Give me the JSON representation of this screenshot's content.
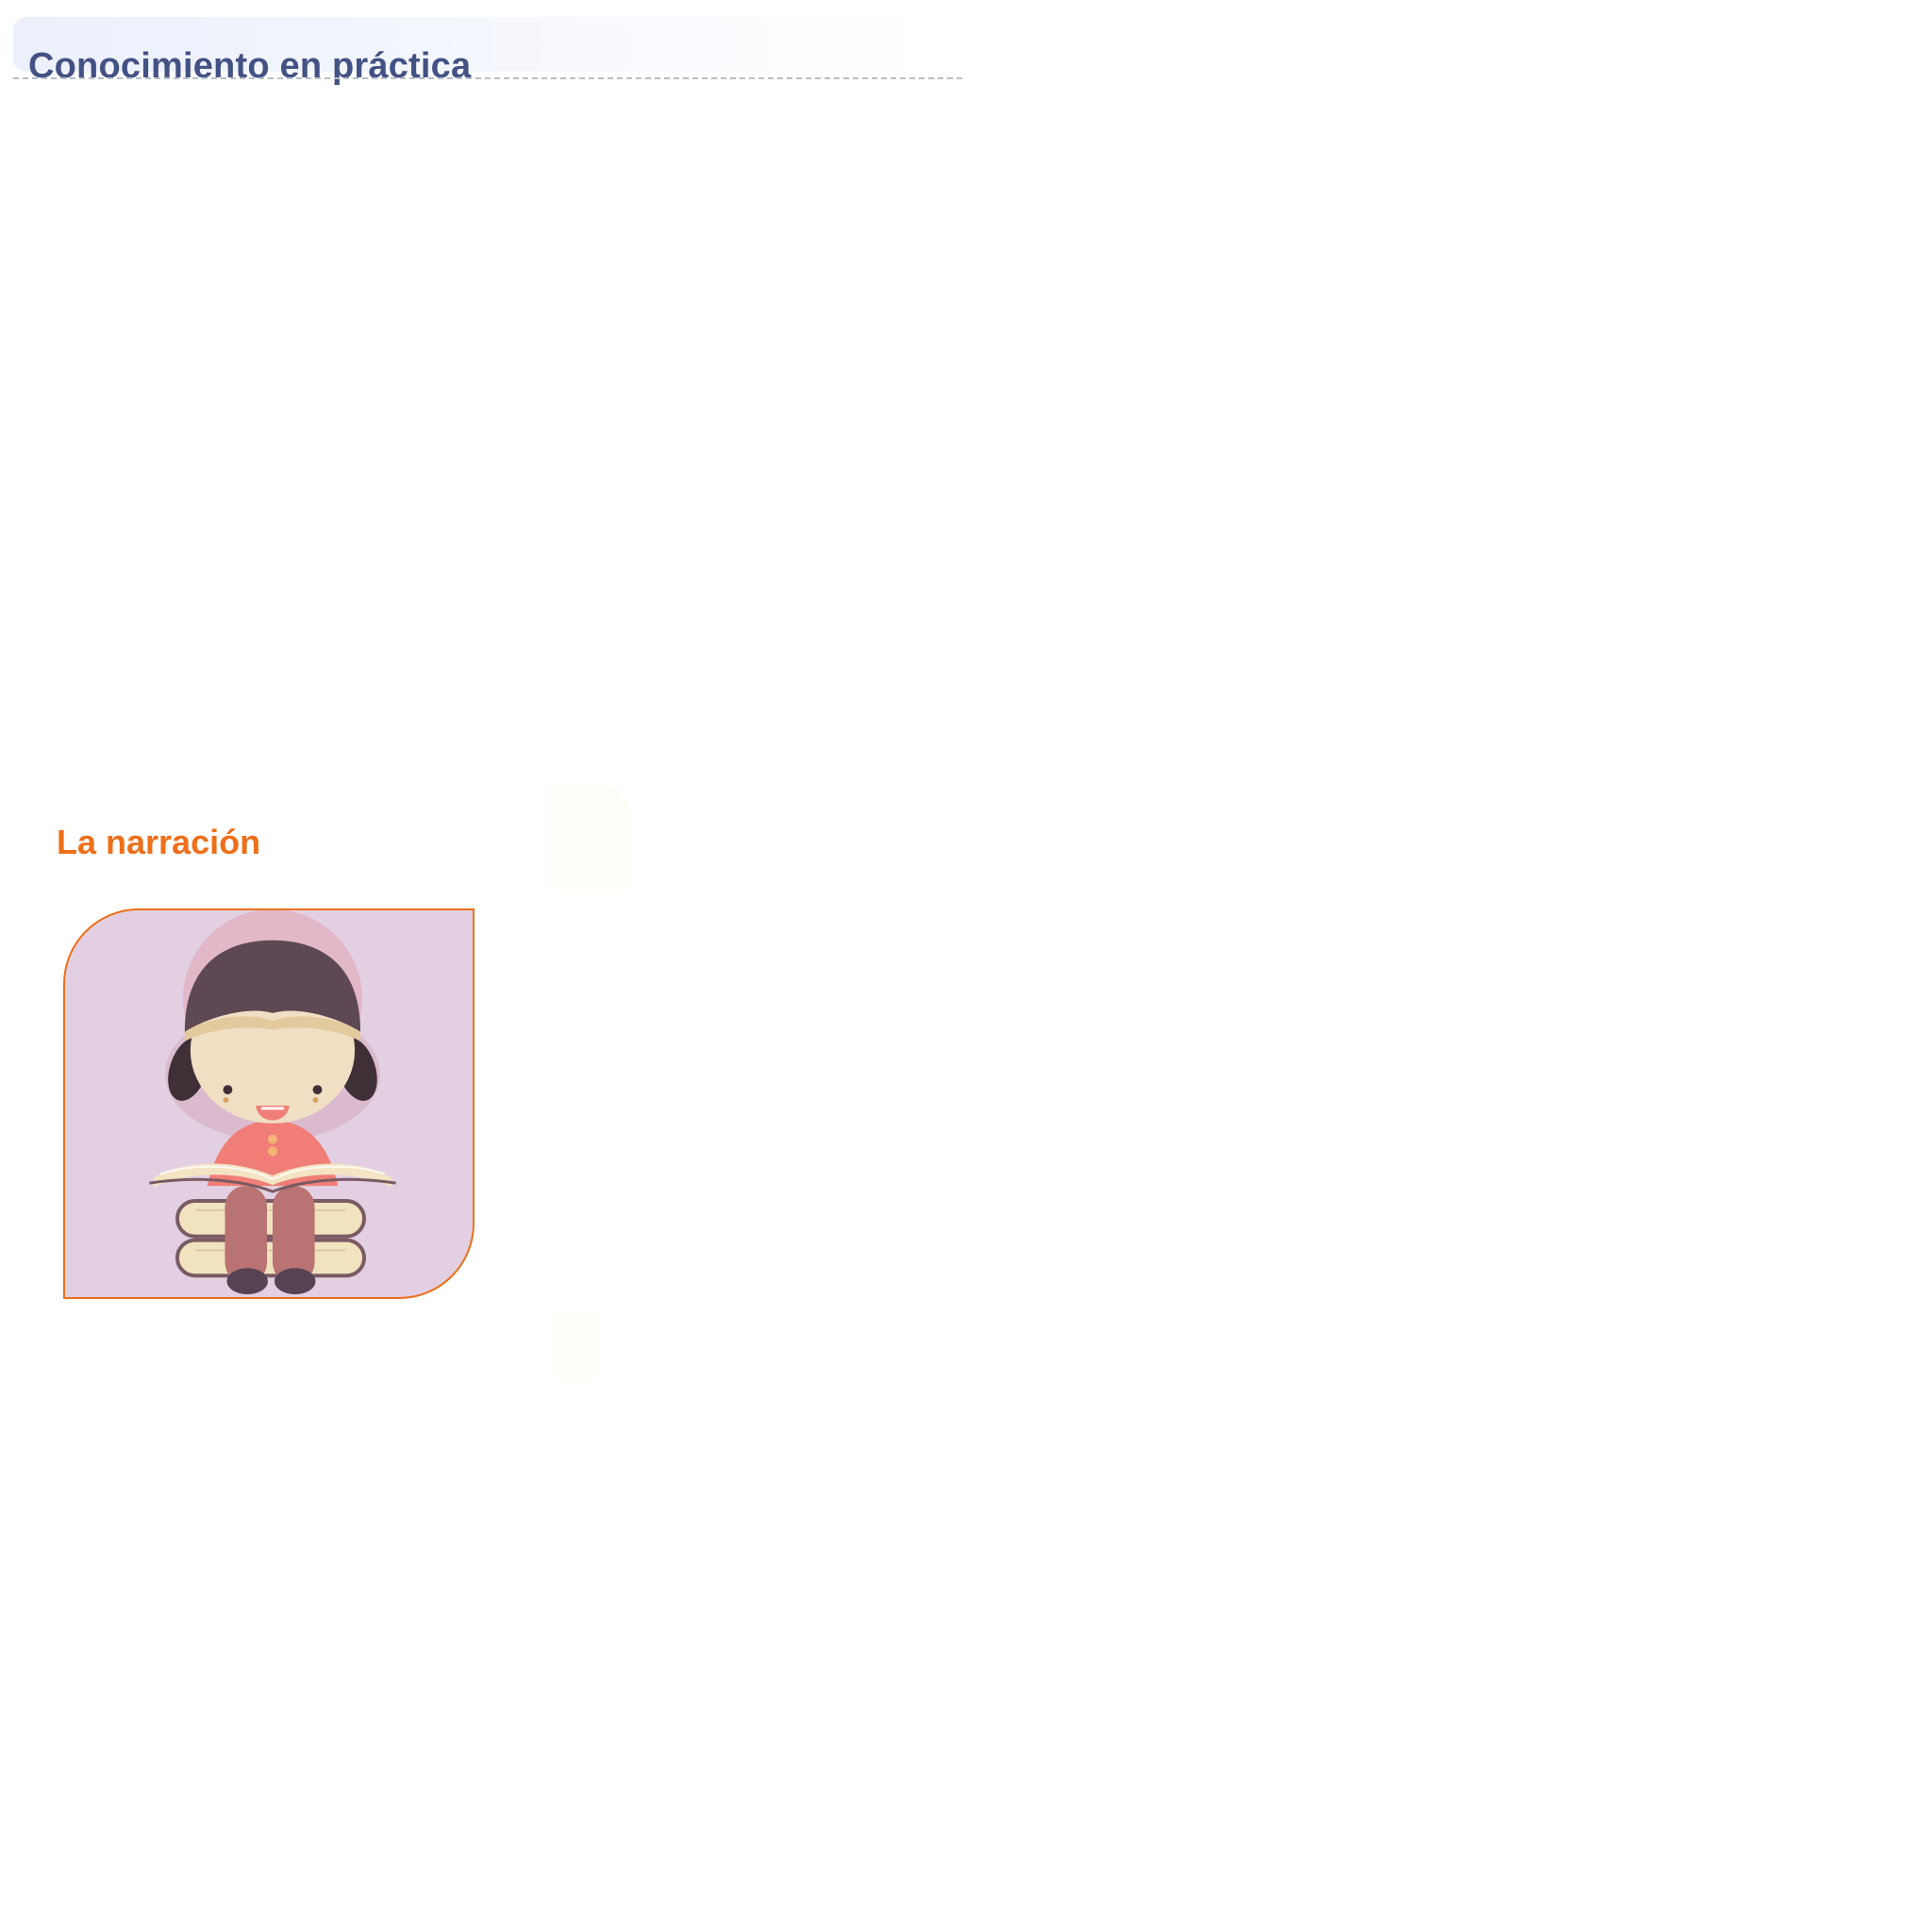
{
  "header": {
    "title": "Conocimiento en práctica"
  },
  "section": {
    "title": "La narración"
  },
  "illustration": {
    "icon": "girl-reading-book-icon"
  },
  "colors": {
    "header_text": "#435284",
    "header_band": "#ecf0fb",
    "accent_orange": "#ee6f1a",
    "card_background": "#e2d0e2"
  }
}
